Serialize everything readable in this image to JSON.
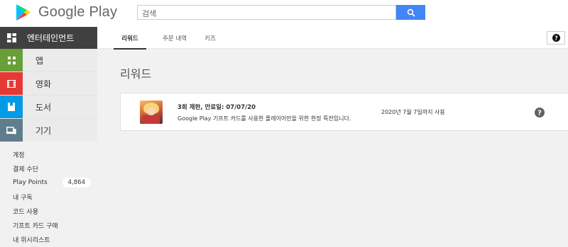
{
  "header": {
    "logo_text": "Google Play",
    "search_placeholder": "검색"
  },
  "sidebar": {
    "entertainment_label": "엔터테인먼트",
    "categories": [
      {
        "label": "앱",
        "color": "#689f38",
        "icon": "apps-grid-icon"
      },
      {
        "label": "영화",
        "color": "#e53935",
        "icon": "film-icon"
      },
      {
        "label": "도서",
        "color": "#039be5",
        "icon": "book-icon"
      },
      {
        "label": "기기",
        "color": "#607d8b",
        "icon": "devices-icon"
      }
    ],
    "links": [
      {
        "label": "계정"
      },
      {
        "label": "결제 수단"
      },
      {
        "label": "Play Points",
        "badge": "4,864"
      },
      {
        "label": "내 구독"
      },
      {
        "label": "코드 사용"
      },
      {
        "label": "기프트 카드 구매"
      },
      {
        "label": "내 위시리스트"
      }
    ]
  },
  "tabs": [
    {
      "label": "리워드",
      "active": true
    },
    {
      "label": "주문 내역",
      "active": false
    },
    {
      "label": "키즈",
      "active": false
    }
  ],
  "main": {
    "page_title": "리워드",
    "reward": {
      "title": "3회 제한, 만료일: 07/07/20",
      "description": "Google Play 기프트 카드를 사용한 플레이어만을 위한 한정 특전입니다.",
      "date": "2020년 7월 7일까지 사용"
    }
  },
  "colors": {
    "search_button": "#4285f4",
    "entertainment_bg": "#404040"
  }
}
